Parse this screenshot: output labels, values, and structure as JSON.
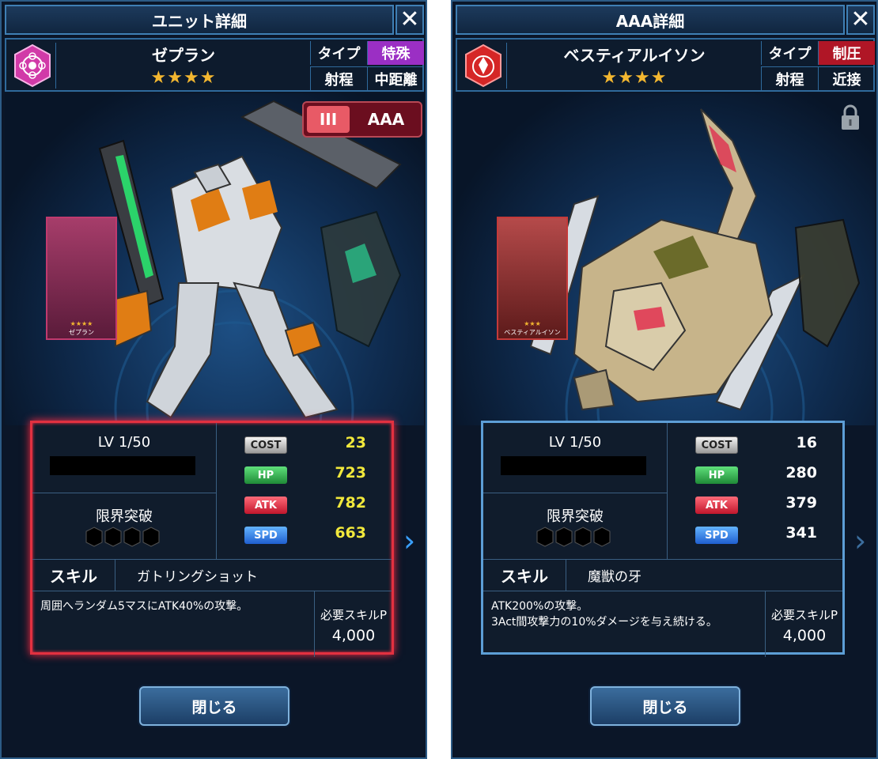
{
  "left": {
    "title": "ユニット詳細",
    "close_glyph": "✕",
    "unit_name": "ゼプラン",
    "stars": "★★★★",
    "type_label": "タイプ",
    "type_value": "特殊",
    "type_color": "#9b2fc4",
    "range_label": "射程",
    "range_value": "中距離",
    "emblem_color": "#d13aa8",
    "rank_roman": "III",
    "rank_text": "AAA",
    "card_name": "ゼプラン",
    "card_stars": "★★★★",
    "lv": "LV 1/50",
    "limit_break": "限界突破",
    "stats": {
      "cost_label": "COST",
      "cost": "23",
      "hp_label": "HP",
      "hp": "723",
      "atk_label": "ATK",
      "atk": "782",
      "spd_label": "SPD",
      "spd": "663"
    },
    "skill_label": "スキル",
    "skill_name": "ガトリングショット",
    "skill_desc_1": "周囲へランダム5マスにATK40%の攻撃。",
    "skill_desc_2": "",
    "req_label": "必要スキルP",
    "req_value": "4,000",
    "next_arrow": "›",
    "close_button": "閉じる"
  },
  "right": {
    "title": "AAA詳細",
    "close_glyph": "✕",
    "unit_name": "ベスティアルイソン",
    "stars": "★★★★",
    "type_label": "タイプ",
    "type_value": "制圧",
    "type_color": "#b01626",
    "range_label": "射程",
    "range_value": "近接",
    "emblem_color": "#d52626",
    "card_name": "ベスティアルイソン",
    "card_stars": "★★★",
    "lv": "LV 1/50",
    "limit_break": "限界突破",
    "stats": {
      "cost_label": "COST",
      "cost": "16",
      "hp_label": "HP",
      "hp": "280",
      "atk_label": "ATK",
      "atk": "379",
      "spd_label": "SPD",
      "spd": "341"
    },
    "skill_label": "スキル",
    "skill_name": "魔獣の牙",
    "skill_desc_1": "ATK200%の攻撃。",
    "skill_desc_2": "3Act間攻撃力の10%ダメージを与え続ける。",
    "req_label": "必要スキルP",
    "req_value": "4,000",
    "next_arrow": "›",
    "close_button": "閉じる"
  }
}
